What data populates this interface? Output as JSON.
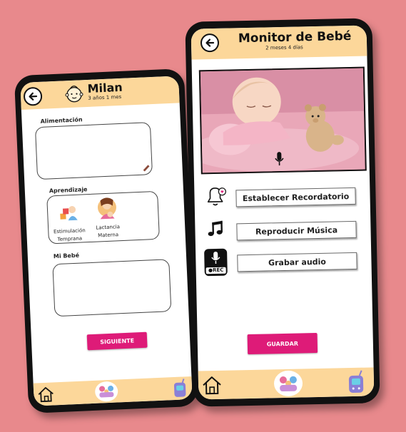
{
  "left_screen": {
    "title": "Milan",
    "subtitle": "3 años 1 mes",
    "sections": {
      "feeding": "Alimentación",
      "learning": "Aprendizaje",
      "my_baby": "Mi Bebé"
    },
    "learning_items": [
      {
        "line1": "Estimulación",
        "line2": "Temprana"
      },
      {
        "line1": "Lactancia",
        "line2": "Materna"
      }
    ],
    "next_button": "SIGUIENTE"
  },
  "right_screen": {
    "title": "Monitor de Bebé",
    "subtitle": "2 meses 4 días",
    "options": [
      {
        "label": "Establecer Recordatorio",
        "icon": "bell-icon"
      },
      {
        "label": "Reproducir Música",
        "icon": "music-note-icon"
      },
      {
        "label": "Grabar audio",
        "icon": "rec-microphone-icon"
      }
    ],
    "rec_badge": "●REC",
    "save_button": "GUARDAR"
  },
  "colors": {
    "background": "#e8898c",
    "header": "#fcd79a",
    "accent": "#de1b78"
  }
}
